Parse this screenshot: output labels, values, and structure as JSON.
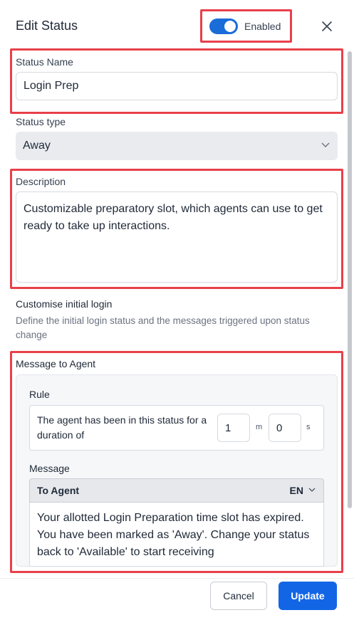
{
  "header": {
    "title": "Edit Status",
    "toggle_label": "Enabled",
    "toggle_on": true
  },
  "status_name": {
    "label": "Status Name",
    "value": "Login Prep"
  },
  "status_type": {
    "label": "Status type",
    "value": "Away"
  },
  "description": {
    "label": "Description",
    "value": "Customizable preparatory slot, which agents can use to get ready to take up interactions."
  },
  "initial_login": {
    "heading": "Customise initial login",
    "help": "Define the initial login status and the messages triggered upon status change"
  },
  "message_to_agent": {
    "heading": "Message to Agent",
    "rule_label": "Rule",
    "rule_text": "The agent has been in this status for a duration of",
    "minutes_value": "1",
    "minutes_unit": "m",
    "seconds_value": "0",
    "seconds_unit": "s",
    "message_label": "Message",
    "recipient": "To Agent",
    "language": "EN",
    "message_text": "Your allotted Login Preparation time slot has expired. You have been marked as 'Away'. Change your status back to 'Available' to start receiving"
  },
  "footer": {
    "cancel_label": "Cancel",
    "update_label": "Update"
  },
  "colors": {
    "accent": "#1266e6",
    "highlight": "#e8404a"
  }
}
